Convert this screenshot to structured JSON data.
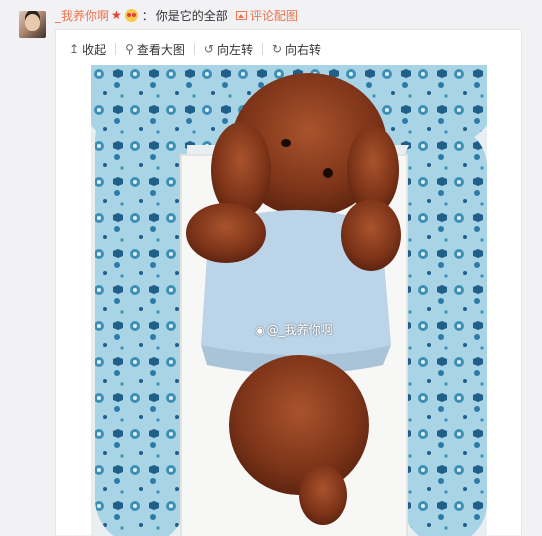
{
  "post": {
    "username": "_我养你啊",
    "badge_star": "★",
    "colon": "：",
    "comment_text": "你是它的全部",
    "comment_image_label": "评论配图"
  },
  "toolbar": {
    "collapse_icon": "↥",
    "collapse_label": "收起",
    "view_large_icon": "⚲",
    "view_large_label": "查看大图",
    "rotate_left_icon": "↺",
    "rotate_left_label": "向左转",
    "rotate_right_icon": "↻",
    "rotate_right_label": "向右转"
  },
  "photo": {
    "subject": "poodle-puppy-in-blue-bed",
    "watermark_logo": "◉",
    "watermark_text": "@_我养你啊"
  },
  "colors": {
    "accent": "#eb7350",
    "page_bg": "#f2f2f5",
    "bed_blue": "#a8d4e6",
    "puppy_brown": "#8a3d1f"
  }
}
